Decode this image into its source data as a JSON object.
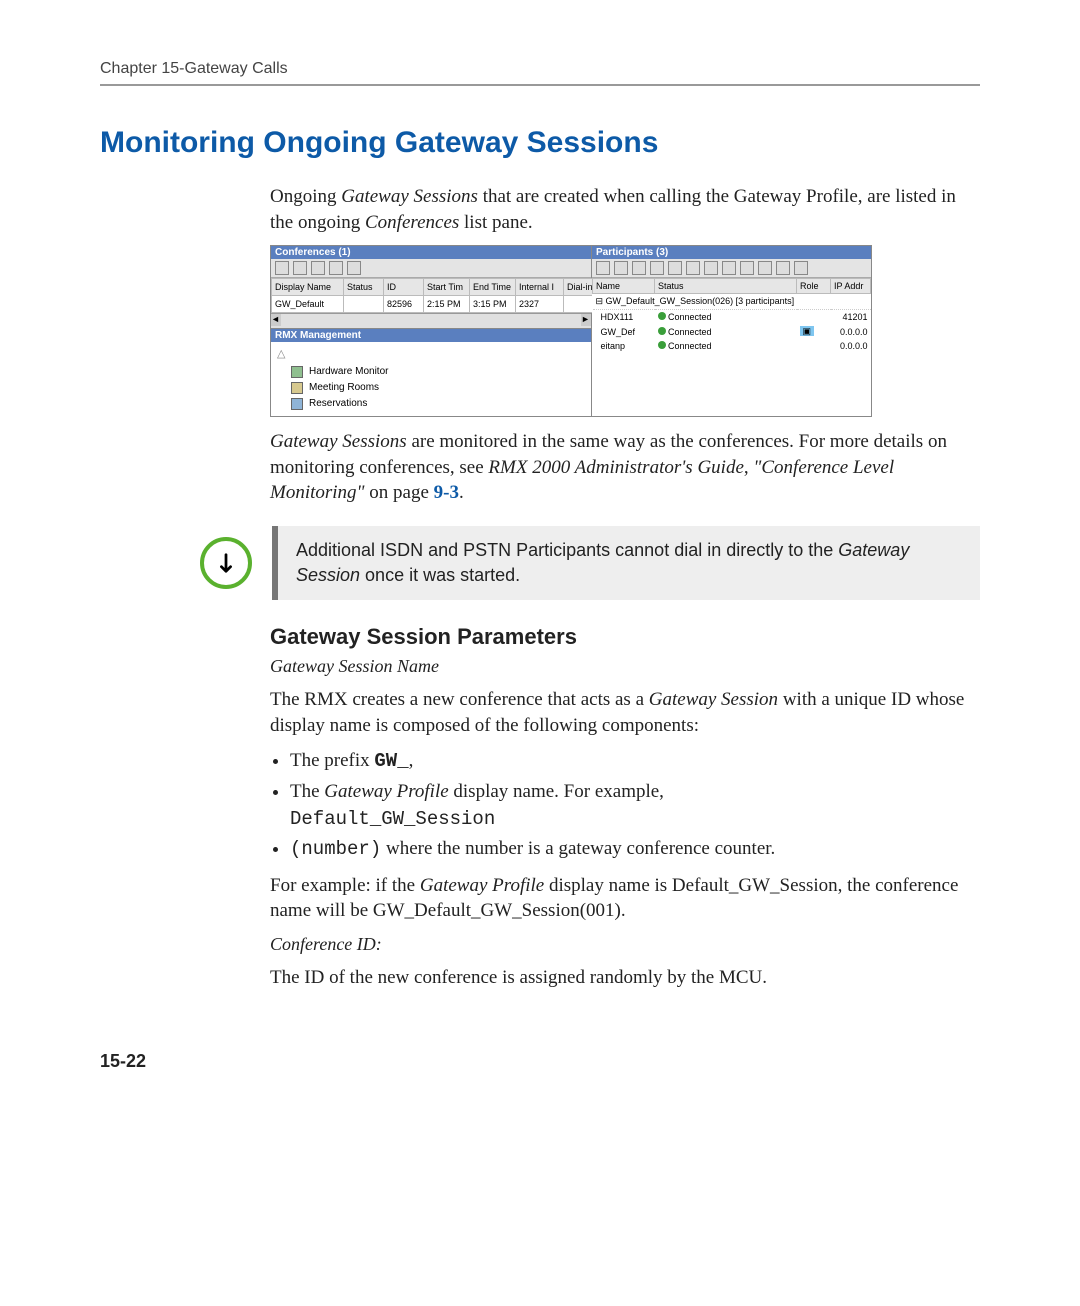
{
  "header": {
    "chapter": "Chapter 15-Gateway Calls"
  },
  "section_title": "Monitoring Ongoing Gateway Sessions",
  "intro": {
    "p1_a": "Ongoing ",
    "p1_b": "Gateway Sessions",
    "p1_c": " that are created when calling the Gateway Profile, are listed in the ongoing ",
    "p1_d": "Conferences",
    "p1_e": " list pane."
  },
  "screenshot": {
    "conferences": {
      "title": "Conferences (1)",
      "columns": [
        "Display Name",
        "Status",
        "ID",
        "Start Tim",
        "End Time",
        "Internal I",
        "Dial-in"
      ],
      "row": {
        "name": "GW_Default",
        "status": "",
        "id": "82596",
        "start": "2:15 PM",
        "end": "3:15 PM",
        "internal": "2327",
        "dialin": ""
      }
    },
    "rmx": {
      "title": "RMX Management",
      "items": [
        "Hardware Monitor",
        "Meeting Rooms",
        "Reservations"
      ]
    },
    "participants": {
      "title": "Participants (3)",
      "columns": [
        "Name",
        "Status",
        "Role",
        "IP Addr"
      ],
      "group": "GW_Default_GW_Session(026) [3 participants]",
      "rows": [
        {
          "name": "HDX111",
          "status": "Connected",
          "role": "",
          "ip": "41201"
        },
        {
          "name": "GW_Def",
          "status": "Connected",
          "role": "",
          "ip": "0.0.0.0"
        },
        {
          "name": "eitanp",
          "status": "Connected",
          "role": "",
          "ip": "0.0.0.0"
        }
      ]
    }
  },
  "after_shot": {
    "a": "Gateway Sessions",
    "b": " are monitored in the same way as the conferences. For more details on monitoring conferences, see ",
    "c": "RMX 2000 Administrator's Guide",
    "d": ", ",
    "e": "\"Conference Level Monitoring\"",
    "f": " on page ",
    "g": "9-3",
    "h": "."
  },
  "note": {
    "a": "Additional ISDN and PSTN Participants cannot dial in directly to the ",
    "b": "Gateway Session",
    "c": " once it was started."
  },
  "subheading": "Gateway Session Parameters",
  "gsname": {
    "title": "Gateway Session Name",
    "p1_a": "The RMX creates a new conference that acts as a ",
    "p1_b": "Gateway Session",
    "p1_c": " with a unique ID whose display name is composed of the following components:",
    "li1_a": "The prefix ",
    "li1_b": "GW_",
    "li1_c": ",",
    "li2_a": "The ",
    "li2_b": "Gateway Profile",
    "li2_c": " display name. For example, ",
    "li2_d": "Default_GW_Session",
    "li3_a": "(number)",
    "li3_b": " where the number is a gateway conference counter.",
    "p2_a": "For example: if the ",
    "p2_b": "Gateway Profile",
    "p2_c": " display name is Default_GW_Session, the conference name will be GW_Default_GW_Session(001)."
  },
  "confid": {
    "title": "Conference ID:",
    "p": "The ID of the new conference is assigned randomly by the MCU."
  },
  "page_num": "15-22"
}
